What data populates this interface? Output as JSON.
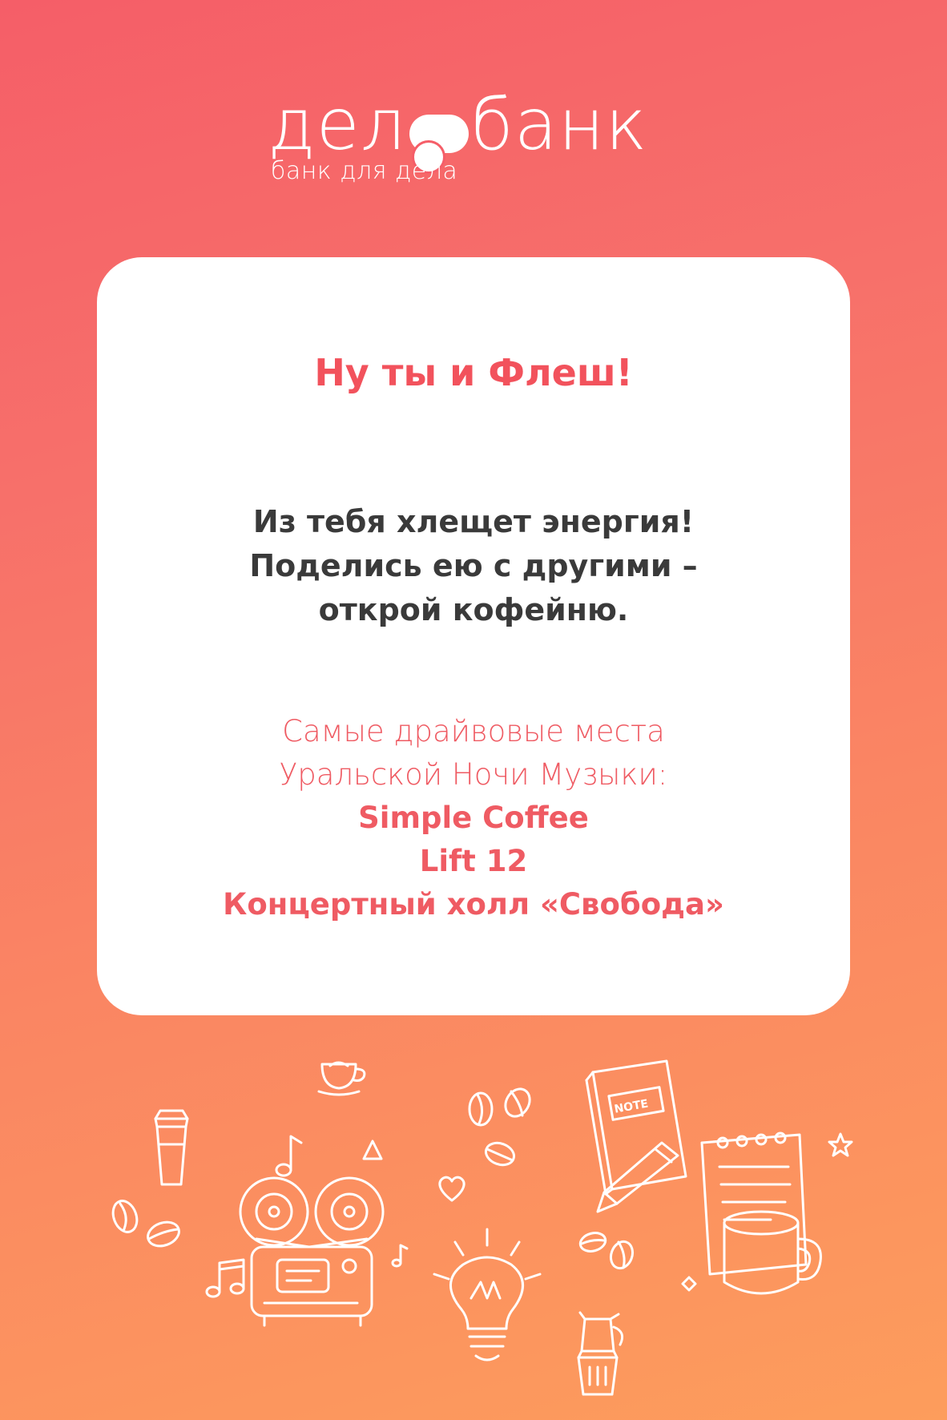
{
  "brand": {
    "logo_left": "дел",
    "logo_right": "банк",
    "tagline": "банк для дела"
  },
  "card": {
    "title": "Ну ты и Флеш!",
    "body_lines": [
      "Из тебя хлещет энергия!",
      "Поделись ею с другими –",
      "открой кофейню."
    ],
    "places_intro_lines": [
      "Самые драйвовые места",
      "Уральской Ночи Музыки:"
    ],
    "places": [
      "Simple Coffee",
      "Lift 12",
      "Концертный холл «Свобода»"
    ]
  },
  "doodles": {
    "notebook_label": "NOTE",
    "icons": [
      "coffee-cup-icon",
      "takeaway-cup-icon",
      "coffee-beans-icon",
      "music-note-icon",
      "reel-tape-recorder-icon",
      "heart-icon",
      "triangle-icon",
      "lightbulb-icon",
      "notebook-icon",
      "pencil-icon",
      "notepad-icon",
      "mug-icon",
      "moka-pot-icon",
      "star-icon"
    ]
  },
  "colors": {
    "gradient_top": "#f55e68",
    "gradient_bottom": "#fd9d5c",
    "title_red": "#f2525c",
    "body_dark": "#3a3a3a",
    "card_white": "#ffffff"
  }
}
